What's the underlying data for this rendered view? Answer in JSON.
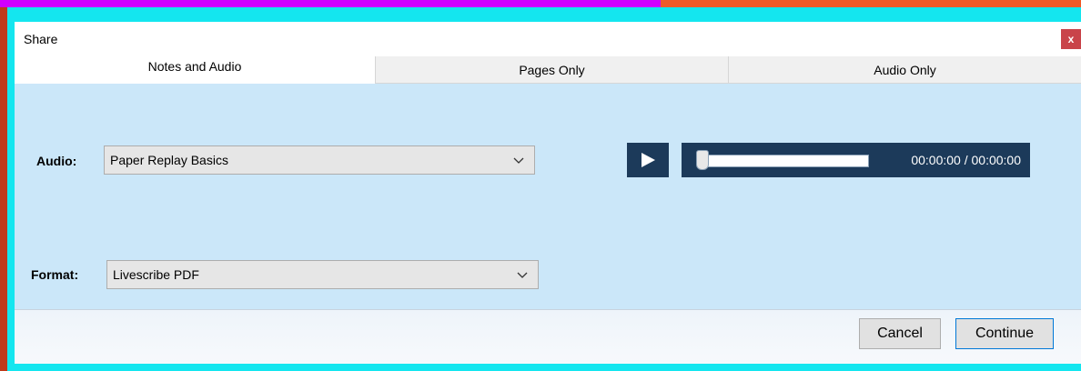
{
  "window": {
    "title": "Share",
    "close_glyph": "x"
  },
  "tabs": [
    {
      "label": "Notes and Audio",
      "active": true
    },
    {
      "label": "Pages Only",
      "active": false
    },
    {
      "label": "Audio Only",
      "active": false
    }
  ],
  "audio": {
    "label": "Audio:",
    "selected": "Paper Replay Basics",
    "icon": "chevron-down-icon"
  },
  "format": {
    "label": "Format:",
    "selected": "Livescribe PDF",
    "icon": "chevron-down-icon"
  },
  "player": {
    "play_icon": "play-icon",
    "progress": 0,
    "time": "00:00:00 / 00:00:00"
  },
  "footer": {
    "cancel_label": "Cancel",
    "continue_label": "Continue"
  },
  "colors": {
    "panel": "#cbe7f9",
    "player": "#1c3a5a",
    "close": "#c9444a"
  }
}
